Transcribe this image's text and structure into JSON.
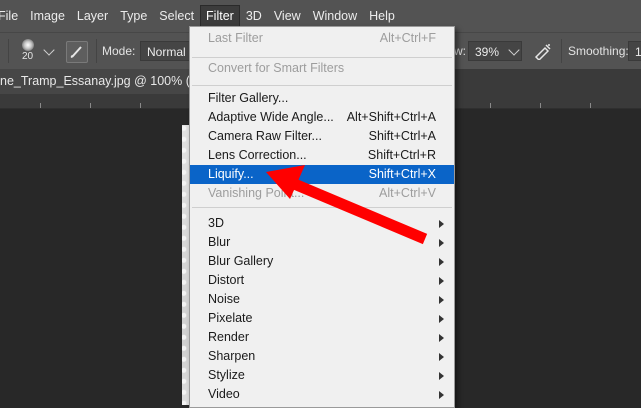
{
  "menubar": {
    "items": [
      {
        "name": "menu-file",
        "label": "File"
      },
      {
        "name": "menu-image",
        "label": "Image"
      },
      {
        "name": "menu-layer",
        "label": "Layer"
      },
      {
        "name": "menu-type",
        "label": "Type"
      },
      {
        "name": "menu-select",
        "label": "Select"
      },
      {
        "name": "menu-filter",
        "label": "Filter"
      },
      {
        "name": "menu-3d",
        "label": "3D"
      },
      {
        "name": "menu-view",
        "label": "View"
      },
      {
        "name": "menu-window",
        "label": "Window"
      },
      {
        "name": "menu-help",
        "label": "Help"
      }
    ],
    "active_menu": "Filter"
  },
  "options_bar": {
    "brush_size": "20",
    "mode_label": "Mode:",
    "mode_value": "Normal",
    "flow_label": "w:",
    "flow_value": "39%",
    "smoothing_label": "Smoothing:",
    "smoothing_value": "1"
  },
  "document": {
    "tab_title": "ne_Tramp_Essanay.jpg @ 100% (Lay"
  },
  "filter_menu": {
    "items": [
      {
        "label": "Last Filter",
        "shortcut": "Alt+Ctrl+F",
        "state": "disabled"
      },
      {
        "label": "Convert for Smart Filters",
        "shortcut": "",
        "state": "disabled"
      },
      {
        "label": "Filter Gallery...",
        "shortcut": "",
        "state": "enabled"
      },
      {
        "label": "Adaptive Wide Angle...",
        "shortcut": "Alt+Shift+Ctrl+A",
        "state": "enabled"
      },
      {
        "label": "Camera Raw Filter...",
        "shortcut": "Shift+Ctrl+A",
        "state": "enabled"
      },
      {
        "label": "Lens Correction...",
        "shortcut": "Shift+Ctrl+R",
        "state": "enabled"
      },
      {
        "label": "Liquify...",
        "shortcut": "Shift+Ctrl+X",
        "state": "highlighted"
      },
      {
        "label": "Vanishing Point...",
        "shortcut": "Alt+Ctrl+V",
        "state": "disabled"
      },
      {
        "label": "3D",
        "submenu": true
      },
      {
        "label": "Blur",
        "submenu": true
      },
      {
        "label": "Blur Gallery",
        "submenu": true
      },
      {
        "label": "Distort",
        "submenu": true
      },
      {
        "label": "Noise",
        "submenu": true
      },
      {
        "label": "Pixelate",
        "submenu": true
      },
      {
        "label": "Render",
        "submenu": true
      },
      {
        "label": "Sharpen",
        "submenu": true
      },
      {
        "label": "Stylize",
        "submenu": true
      },
      {
        "label": "Video",
        "submenu": true
      }
    ]
  },
  "colors": {
    "menubar_bg": "#535353",
    "highlight": "#0a64c8",
    "annotation_arrow": "#ff0000",
    "workspace_bg": "#282828"
  }
}
